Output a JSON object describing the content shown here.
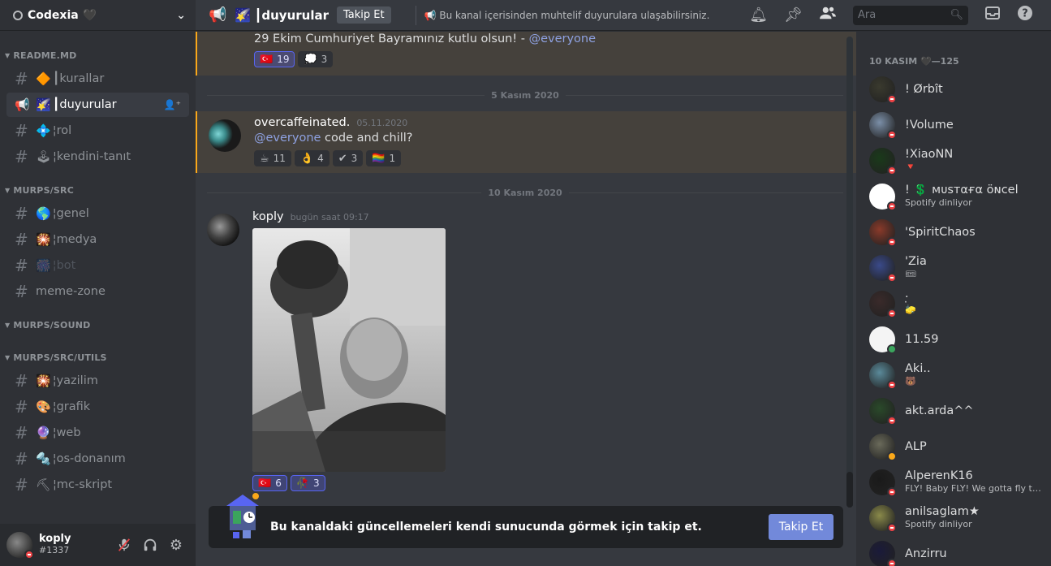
{
  "server": {
    "name": "Codexia 🖤"
  },
  "channels": {
    "categories": [
      {
        "name": "README.MD",
        "items": [
          {
            "prefix": "#",
            "emoji": "🔶",
            "label": "┃kurallar",
            "state": "normal"
          },
          {
            "prefix": "📢",
            "emoji": "🌠",
            "label": "┃duyurular",
            "state": "active"
          },
          {
            "prefix": "#",
            "emoji": "💠",
            "label": "¦rol",
            "state": "normal"
          },
          {
            "prefix": "#",
            "emoji": "🕹",
            "label": "¦kendini-tanıt",
            "state": "normal"
          }
        ]
      },
      {
        "name": "MURPS/SRC",
        "items": [
          {
            "prefix": "#",
            "emoji": "🌎",
            "label": "¦genel",
            "state": "normal"
          },
          {
            "prefix": "#",
            "emoji": "🎇",
            "label": "¦medya",
            "state": "normal"
          },
          {
            "prefix": "#",
            "emoji": "🎆",
            "label": "¦bot",
            "state": "muted"
          },
          {
            "prefix": "#",
            "emoji": "",
            "label": "meme-zone",
            "state": "normal"
          }
        ]
      },
      {
        "name": "MURPS/SOUND",
        "items": []
      },
      {
        "name": "MURPS/SRC/UTILS",
        "items": [
          {
            "prefix": "#",
            "emoji": "🎇",
            "label": "¦yazilim",
            "state": "normal"
          },
          {
            "prefix": "#",
            "emoji": "🎨",
            "label": "¦grafik",
            "state": "normal"
          },
          {
            "prefix": "#",
            "emoji": "🔮",
            "label": "¦web",
            "state": "normal"
          },
          {
            "prefix": "#",
            "emoji": "🔩",
            "label": "¦os-donanım",
            "state": "normal"
          },
          {
            "prefix": "#",
            "emoji": "⛏",
            "label": "¦mc-skript",
            "state": "normal"
          }
        ]
      }
    ]
  },
  "user": {
    "name": "koply",
    "tag": "#1337"
  },
  "topbar": {
    "channel_emoji": "🌠",
    "channel_name": "┃duyurular",
    "follow_label": "Takip Et",
    "topic": "📢 Bu kanal içerisinden muhtelif duyurulara ulaşabilirsiniz.",
    "search_placeholder": "Ara"
  },
  "messages": {
    "first": {
      "text": "29 Ekim Cumhuriyet Bayramınız kutlu olsun! - ",
      "mention": "@everyone",
      "reactions": [
        {
          "emoji": "🇹🇷",
          "count": "19",
          "me": true
        },
        {
          "emoji": "💭",
          "count": "3",
          "me": false
        }
      ]
    },
    "divider1": "5 Kasım 2020",
    "second": {
      "author": "overcaffeinated.",
      "time": "05.11.2020",
      "mention": "@everyone",
      "text": " code and chill?",
      "reactions": [
        {
          "emoji": "☕",
          "count": "11",
          "me": false
        },
        {
          "emoji": "👌",
          "count": "4",
          "me": false
        },
        {
          "emoji": "✔",
          "count": "3",
          "me": false
        },
        {
          "emoji": "🏳️‍🌈",
          "count": "1",
          "me": false
        }
      ]
    },
    "divider2": "10 Kasım 2020",
    "third": {
      "author": "koply",
      "time": "bugün saat 09:17",
      "reactions": [
        {
          "emoji": "🇹🇷",
          "count": "6",
          "me": true
        },
        {
          "emoji": "🥀",
          "count": "3",
          "me": true
        }
      ]
    }
  },
  "banner": {
    "text": "Bu kanaldaki güncellemeleri kendi sunucunda görmek için takip et.",
    "button": "Takip Et"
  },
  "members": {
    "category": "10 KASIM 🖤—125",
    "list": [
      {
        "name": "! Ørbît",
        "activity": "",
        "status": "dnd",
        "color": "#3a3a2e"
      },
      {
        "name": "!Volume",
        "activity": "",
        "status": "dnd",
        "color": "#7b8fa8"
      },
      {
        "name": "!XiaoNN",
        "activity": "🔻",
        "status": "dnd",
        "color": "#1a3a1a"
      },
      {
        "name": "! 💲 ᴍᴜsᴛαғα öɴcel",
        "activity": "Spotify dinliyor",
        "status": "dnd",
        "color": "#ffffff"
      },
      {
        "name": "'SpiritChaos",
        "activity": "",
        "status": "dnd",
        "color": "#8a3a2a"
      },
      {
        "name": "'Zia",
        "activity": "🎟",
        "status": "dnd",
        "color": "#3a4a8a"
      },
      {
        "name": "·̣",
        "activity": "🧽",
        "status": "dnd",
        "color": "#3a2a2a"
      },
      {
        "name": "11.59",
        "activity": "",
        "status": "online",
        "color": "#f4f4f4"
      },
      {
        "name": "Aki..",
        "activity": "🐻",
        "status": "dnd",
        "color": "#5a8a9a"
      },
      {
        "name": "akt.arda^^",
        "activity": "",
        "status": "dnd",
        "color": "#2a4a2a"
      },
      {
        "name": "ALP",
        "activity": "",
        "status": "idle",
        "color": "#6a6a5a"
      },
      {
        "name": "AlperenK16",
        "activity": "FLY! Baby FLY! We gotta fly to ...",
        "status": "dnd",
        "color": "#1a1a1a"
      },
      {
        "name": "anilsaglam★",
        "activity": "Spotify dinliyor",
        "status": "dnd",
        "color": "#8a8a4a"
      },
      {
        "name": "Anzirru",
        "activity": "",
        "status": "dnd",
        "color": "#1a1a3a"
      }
    ]
  }
}
